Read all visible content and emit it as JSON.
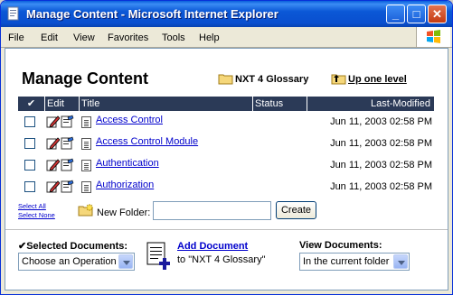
{
  "window": {
    "title": "Manage Content - Microsoft Internet Explorer",
    "controls": {
      "minimize": "_",
      "maximize": "□",
      "close": "✕"
    }
  },
  "menu": [
    "File",
    "Edit",
    "View",
    "Favorites",
    "Tools",
    "Help"
  ],
  "page": {
    "title": "Manage Content",
    "glossary_link": "NXT 4 Glossary",
    "up_link": "Up one level"
  },
  "grid": {
    "headers": {
      "check": "✔",
      "edit": "Edit",
      "title": "Title",
      "status": "Status",
      "modified": "Last-Modified"
    },
    "rows": [
      {
        "title": "Access Control",
        "status": "",
        "modified": "Jun 11, 2003 02:58 PM"
      },
      {
        "title": "Access Control Module",
        "status": "",
        "modified": "Jun 11, 2003 02:58 PM"
      },
      {
        "title": "Authentication",
        "status": "",
        "modified": "Jun 11, 2003 02:58 PM"
      },
      {
        "title": "Authorization",
        "status": "",
        "modified": "Jun 11, 2003 02:58 PM"
      }
    ]
  },
  "selection": {
    "select_all": "Select All",
    "select_none": "Select None"
  },
  "new_folder": {
    "label": "New Folder:",
    "value": "",
    "button": "Create"
  },
  "footer": {
    "selected_docs_label": "✔Selected Documents:",
    "operation_select": "Choose an Operation",
    "add_document": "Add Document",
    "add_document_target": "to \"NXT 4 Glossary\"",
    "view_docs_label": "View Documents:",
    "view_select": "In the current folder"
  },
  "colors": {
    "header_bg": "#2b3a57",
    "link": "#0000cc",
    "titlebar": "#0a4fcf"
  }
}
